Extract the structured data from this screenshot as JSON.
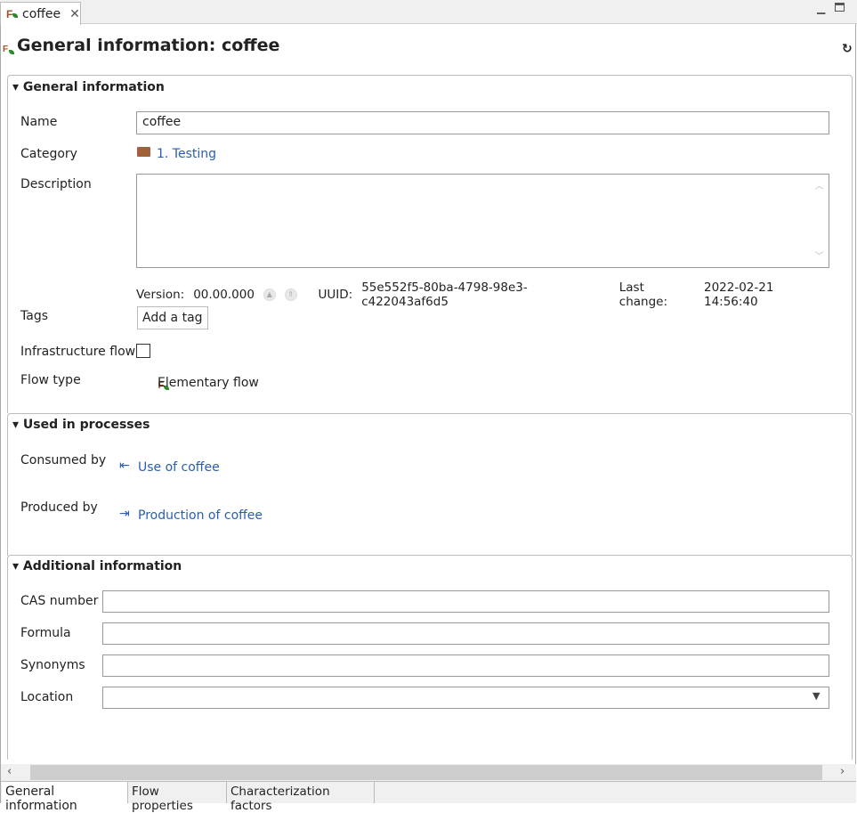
{
  "tab": {
    "label": "coffee"
  },
  "title": "General information: coffee",
  "general": {
    "header": "General information",
    "name_label": "Name",
    "name_value": "coffee",
    "category_label": "Category",
    "category_value": "1. Testing",
    "description_label": "Description",
    "description_value": "",
    "version_label": "Version:",
    "version_value": "00.00.000",
    "uuid_label": "UUID:",
    "uuid_value": "55e552f5-80ba-4798-98e3-c422043af6d5",
    "last_change_label": "Last change:",
    "last_change_value": "2022-02-21 14:56:40",
    "tags_label": "Tags",
    "add_tag": "Add a tag",
    "infra_label": "Infrastructure flow",
    "infra_checked": false,
    "flow_type_label": "Flow type",
    "flow_type_value": "Elementary flow"
  },
  "used": {
    "header": "Used in processes",
    "consumed_label": "Consumed by",
    "consumed_value": "Use of coffee",
    "produced_label": "Produced by",
    "produced_value": "Production of coffee"
  },
  "additional": {
    "header": "Additional information",
    "cas_label": "CAS number",
    "formula_label": "Formula",
    "synonyms_label": "Synonyms",
    "location_label": "Location"
  },
  "bottom_tabs": [
    "General information",
    "Flow properties",
    "Characterization factors"
  ]
}
